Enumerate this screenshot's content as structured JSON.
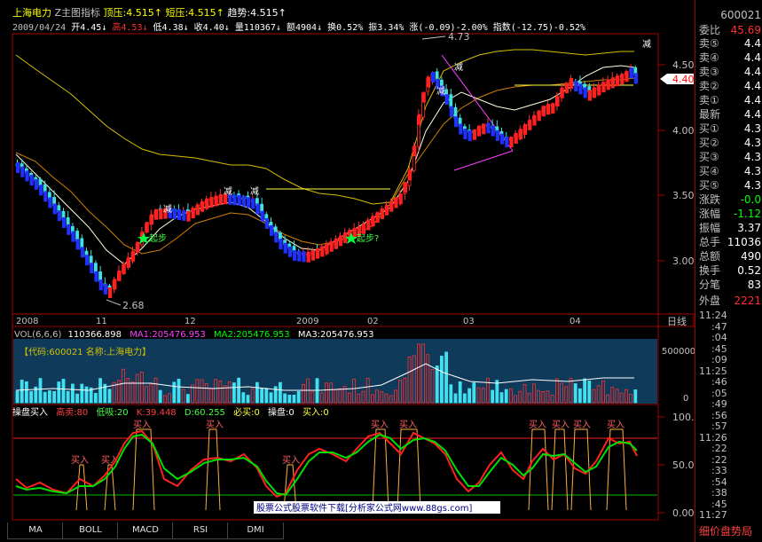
{
  "header": {
    "stock_name": "上海电力",
    "indicator_name": "Z主图指标",
    "top_label": "顶压:4.515↑",
    "short_label": "短压:4.515↑",
    "trend_label": "趋势:4.515↑",
    "date": "2009/04/24",
    "open": "开4.45↓",
    "high": "高4.53↓",
    "low": "低4.38↓",
    "close": "收4.40↓",
    "volume": "量110367↓",
    "amount": "额4904↓",
    "turnover": "换0.52%",
    "amplitude": "振3.34%",
    "change": "涨(-0.09)-2.00%",
    "index": "指数(-12.75)-0.52%"
  },
  "main_chart": {
    "y_ticks": [
      "4.50",
      "4.00",
      "3.50",
      "3.00"
    ],
    "price_marker": "4.40",
    "annotations": {
      "high": "4.73",
      "low": "2.68",
      "jian1": "减",
      "jian2": "减",
      "jian3": "减",
      "jian4": "减",
      "jian5": "减",
      "jian6": "减",
      "qibu1": "起步",
      "qibu2": "起步?"
    },
    "x_ticks": [
      "2008",
      "11",
      "12",
      "2009",
      "02",
      "03",
      "04"
    ],
    "period_label": "日线"
  },
  "volume_panel": {
    "title": "VOL(6,6,6)",
    "vol_value": "110366.898",
    "ma1": "MA1:205476.953",
    "ma2": "MA2:205476.953",
    "ma3": "MA3:205476.953",
    "code_label": "【代码:600021 名称:上海电力】",
    "y_ticks": [
      "500000",
      "0"
    ]
  },
  "indicator_panel": {
    "name": "操盘买入",
    "high_sell": "高卖:80",
    "low_buy": "低吸:20",
    "k": "K:39.448",
    "d": "D:60.255",
    "must_buy": "必买:0",
    "operate": "操盘:0",
    "buy": "买入:0",
    "y_ticks": [
      "100.00",
      "50.00",
      "0.00"
    ],
    "buy_marks": [
      "买入",
      "买入",
      "买入",
      "买入",
      "买入",
      "买入",
      "买入",
      "买入",
      "买入",
      "买入",
      "买入"
    ],
    "watermark": "股票公式股票软件下载[分析家公式网www.88gs.com]"
  },
  "tabs": [
    "MA",
    "BOLL",
    "MACD",
    "RSI",
    "DMI"
  ],
  "right_panel": {
    "code": "600021",
    "ratio_label": "委比",
    "ratio_value": "45.69",
    "quotes": [
      {
        "label": "卖⑤",
        "value": "4.4"
      },
      {
        "label": "卖④",
        "value": "4.4"
      },
      {
        "label": "卖③",
        "value": "4.4"
      },
      {
        "label": "卖②",
        "value": "4.4"
      },
      {
        "label": "卖①",
        "value": "4.4"
      }
    ],
    "latest_label": "最新",
    "latest_value": "4.4",
    "bids": [
      {
        "label": "买①",
        "value": "4.3"
      },
      {
        "label": "买②",
        "value": "4.3"
      },
      {
        "label": "买③",
        "value": "4.3"
      },
      {
        "label": "买④",
        "value": "4.3"
      },
      {
        "label": "买⑤",
        "value": "4.3"
      }
    ],
    "stats": [
      {
        "label": "涨跌",
        "value": "-0.0"
      },
      {
        "label": "涨幅",
        "value": "-1.12"
      },
      {
        "label": "振幅",
        "value": "3.37"
      },
      {
        "label": "总手",
        "value": "11036"
      },
      {
        "label": "总额",
        "value": "490"
      },
      {
        "label": "换手",
        "value": "0.52"
      },
      {
        "label": "分笔",
        "value": "83"
      }
    ],
    "outer_label": "外盘",
    "outer_value": "2221",
    "ticks": [
      "11:24",
      ":47",
      ":04",
      ":45",
      ":09",
      "11:25",
      ":46",
      ":05",
      ":49",
      ":56",
      ":57",
      "11:26",
      ":22",
      ":22",
      ":33",
      ":54",
      ":38",
      ":45",
      "11:27"
    ],
    "bottom_label": "细价盘势局"
  },
  "colors": {
    "up": "#ff2020",
    "down": "#2020ff",
    "k_line": "#ff2020",
    "d_line": "#00ff00",
    "frame": "#a00000",
    "axis_text": "#c0c0c0"
  }
}
